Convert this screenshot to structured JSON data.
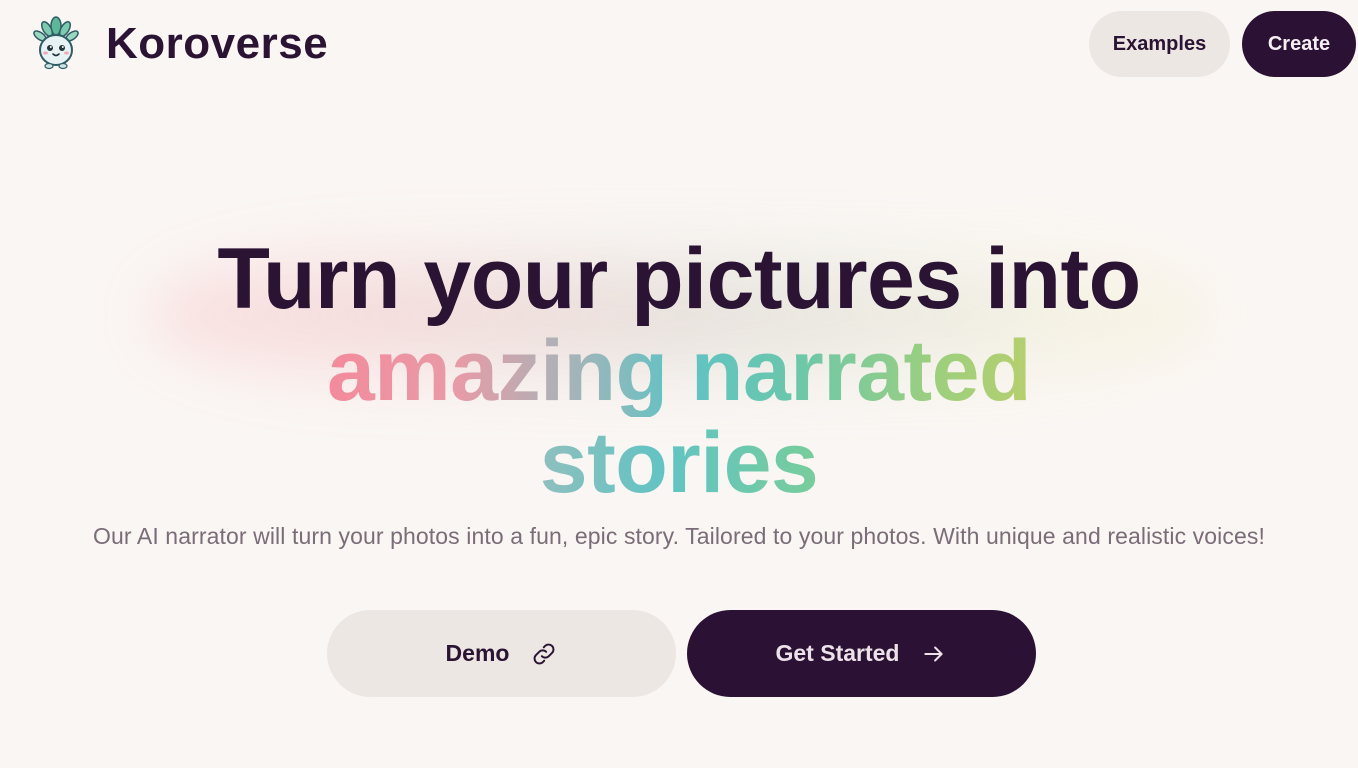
{
  "brand": {
    "name": "Koroverse",
    "logo_icon": "mascot-logo-icon"
  },
  "nav": {
    "examples_label": "Examples",
    "create_label": "Create"
  },
  "hero": {
    "line1": "Turn your pictures into",
    "line2": "amazing narrated",
    "line3": "stories",
    "subtitle": "Our AI narrator will turn your photos into a fun, epic story. Tailored to your photos. With unique and realistic voices!"
  },
  "cta": {
    "demo_label": "Demo",
    "demo_icon": "link-icon",
    "start_label": "Get Started",
    "start_icon": "arrow-right-icon"
  },
  "colors": {
    "background": "#faf6f3",
    "primary_dark": "#2b1133",
    "secondary_light": "#ede7e3",
    "gradient_pink": "#f48a9c",
    "gradient_teal": "#5fc3c4",
    "gradient_green": "#9ccf7f"
  }
}
